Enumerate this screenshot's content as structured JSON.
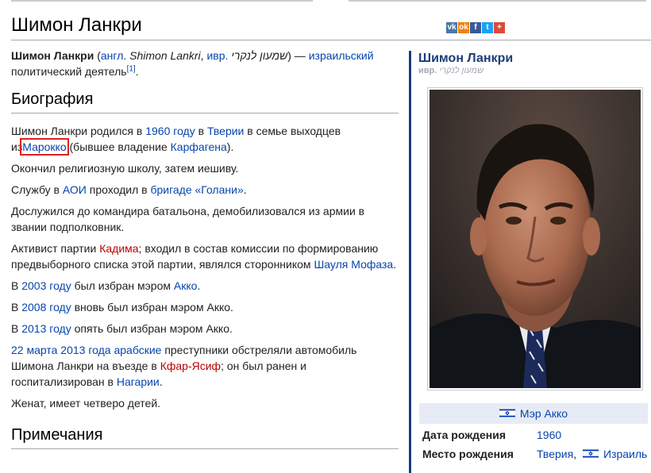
{
  "title": "Шимон Ланкри",
  "share_icons": [
    {
      "name": "vk-icon",
      "glyph": "vk",
      "color": "#4a76a8"
    },
    {
      "name": "odnoklassniki-icon",
      "glyph": "ok",
      "color": "#ee8208"
    },
    {
      "name": "facebook-icon",
      "glyph": "f",
      "color": "#3b5998"
    },
    {
      "name": "twitter-icon",
      "glyph": "t",
      "color": "#1da1f2"
    },
    {
      "name": "plus-icon",
      "glyph": "+",
      "color": "#dd4b39"
    }
  ],
  "lead": {
    "name_bold": "Шимон Ланкри",
    "open": "(",
    "lang_en": "англ.",
    "name_en": "Shimon Lankri",
    "lang_he": "ивр.",
    "name_he": "שמעון לנקרי",
    "dash": ") —",
    "nationality": "израильский",
    "occupation": "политический деятель",
    "ref": "[1]"
  },
  "section_bio": "Биография",
  "bio": {
    "p1_a": "Шимон Ланкри родился в",
    "p1_year": "1960 году",
    "p1_b": "в",
    "p1_city": "Тверии",
    "p1_c": "в семье выходцев из",
    "p1_country": "Марокко",
    "p1_d": "(бывшее владение",
    "p1_carthage": "Карфагена",
    "p1_e": ").",
    "p2": "Окончил религиозную школу, затем иешиву.",
    "p3_a": "Службу в",
    "p3_aoi": "АОИ",
    "p3_b": "проходил в",
    "p3_brigade": "бригаде «Голани»",
    "p3_c": ".",
    "p4": "Дослужился до командира батальона, демобилизовался из армии в звании подполковник.",
    "p5_a": "Активист партии",
    "p5_party": "Кадима",
    "p5_b": "; входил в состав комиссии по формированию предвыборного списка этой партии, являлся сторонником",
    "p5_mofaz": "Шауля Мофаза",
    "p5_c": ".",
    "p6_a": "В",
    "p6_year": "2003 году",
    "p6_b": "был избран мэром",
    "p6_akko": "Акко",
    "p6_c": ".",
    "p7_a": "В",
    "p7_year": "2008 году",
    "p7_b": "вновь был избран мэром Акко.",
    "p8_a": "В",
    "p8_year": "2013 году",
    "p8_b": "опять был избран мэром Акко.",
    "p9_date": "22 марта",
    "p9_year": "2013 года",
    "p9_arab": "арабские",
    "p9_a": "преступники обстреляли автомобиль Шимона Ланкри на въезде в",
    "p9_village": "Кфар-Ясиф",
    "p9_b": "; он был ранен и госпитализирован в",
    "p9_nahariya": "Нагарии",
    "p9_c": ".",
    "p10": "Женат, имеет четверо детей."
  },
  "section_notes": "Примечания",
  "infobox": {
    "title": "Шимон Ланкри",
    "orig_lang": "ивр.",
    "orig_name": "שמעון לנקרי",
    "photo_icon": "portrait-photo",
    "caption": "Мэр Акко",
    "birth_date_label": "Дата рождения",
    "birth_date_value": "1960",
    "birth_place_label": "Место рождения",
    "birth_place_city": "Тверия",
    "birth_place_sep": ",",
    "birth_place_country": "Израиль"
  },
  "colors": {
    "link": "#0645ad",
    "redlink": "#ba0000",
    "infobox_accent": "#1c3d78",
    "highlight": "#e0201f",
    "flag_blue": "#0038b8"
  }
}
